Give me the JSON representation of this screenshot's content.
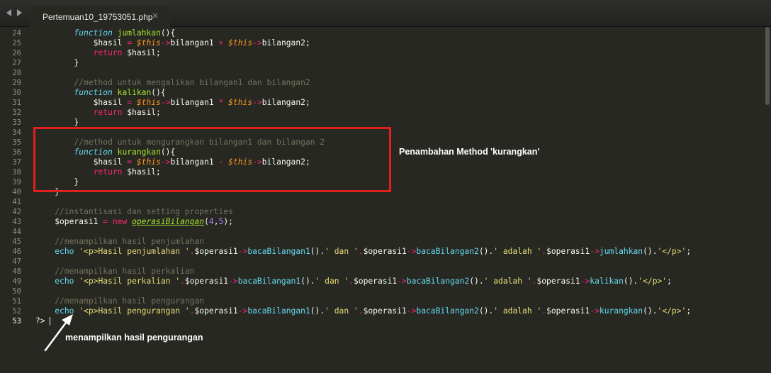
{
  "tab": {
    "title": "Pertemuan10_19753051.php",
    "close": "×"
  },
  "icons": {
    "nav_back": "chevron-left-icon",
    "nav_forward": "chevron-right-icon",
    "close": "close-icon",
    "annotation_arrow": "arrow-up-icon"
  },
  "colors": {
    "background": "#272822",
    "highlight_box": "#e01f1f",
    "annotation_text": "#ffffff"
  },
  "editor": {
    "current_line": 53,
    "lines": [
      {
        "num": "24",
        "tokens": [
          [
            "        ",
            "plain"
          ],
          [
            "function",
            "stor"
          ],
          [
            " ",
            "plain"
          ],
          [
            "jumlahkan",
            "fn"
          ],
          [
            "(){",
            "plain"
          ]
        ]
      },
      {
        "num": "25",
        "tokens": [
          [
            "            $hasil ",
            "plain"
          ],
          [
            "=",
            "op"
          ],
          [
            " ",
            "plain"
          ],
          [
            "$this",
            "this"
          ],
          [
            "->",
            "op"
          ],
          [
            "bilangan1 ",
            "plain"
          ],
          [
            "+",
            "op"
          ],
          [
            " ",
            "plain"
          ],
          [
            "$this",
            "this"
          ],
          [
            "->",
            "op"
          ],
          [
            "bilangan2;",
            "plain"
          ]
        ]
      },
      {
        "num": "26",
        "tokens": [
          [
            "            ",
            "plain"
          ],
          [
            "return",
            "kw"
          ],
          [
            " $hasil;",
            "plain"
          ]
        ]
      },
      {
        "num": "27",
        "tokens": [
          [
            "        }",
            "plain"
          ]
        ]
      },
      {
        "num": "28",
        "tokens": []
      },
      {
        "num": "29",
        "tokens": [
          [
            "        ",
            "plain"
          ],
          [
            "//method untuk mengalikan bilangan1 dan bilangan2",
            "cmt"
          ]
        ]
      },
      {
        "num": "30",
        "tokens": [
          [
            "        ",
            "plain"
          ],
          [
            "function",
            "stor"
          ],
          [
            " ",
            "plain"
          ],
          [
            "kalikan",
            "fn"
          ],
          [
            "(){",
            "plain"
          ]
        ]
      },
      {
        "num": "31",
        "tokens": [
          [
            "            $hasil ",
            "plain"
          ],
          [
            "=",
            "op"
          ],
          [
            " ",
            "plain"
          ],
          [
            "$this",
            "this"
          ],
          [
            "->",
            "op"
          ],
          [
            "bilangan1 ",
            "plain"
          ],
          [
            "*",
            "op"
          ],
          [
            " ",
            "plain"
          ],
          [
            "$this",
            "this"
          ],
          [
            "->",
            "op"
          ],
          [
            "bilangan2;",
            "plain"
          ]
        ]
      },
      {
        "num": "32",
        "tokens": [
          [
            "            ",
            "plain"
          ],
          [
            "return",
            "kw"
          ],
          [
            " $hasil;",
            "plain"
          ]
        ]
      },
      {
        "num": "33",
        "tokens": [
          [
            "        }",
            "plain"
          ]
        ]
      },
      {
        "num": "34",
        "tokens": []
      },
      {
        "num": "35",
        "tokens": [
          [
            "        ",
            "plain"
          ],
          [
            "//method untuk mengurangkan bilangan1 dan bilangan 2",
            "cmt"
          ]
        ]
      },
      {
        "num": "36",
        "tokens": [
          [
            "        ",
            "plain"
          ],
          [
            "function",
            "stor"
          ],
          [
            " ",
            "plain"
          ],
          [
            "kurangkan",
            "fn"
          ],
          [
            "(){",
            "plain"
          ]
        ]
      },
      {
        "num": "37",
        "tokens": [
          [
            "            $hasil ",
            "plain"
          ],
          [
            "=",
            "op"
          ],
          [
            " ",
            "plain"
          ],
          [
            "$this",
            "this"
          ],
          [
            "->",
            "op"
          ],
          [
            "bilangan1 ",
            "plain"
          ],
          [
            "-",
            "op"
          ],
          [
            " ",
            "plain"
          ],
          [
            "$this",
            "this"
          ],
          [
            "->",
            "op"
          ],
          [
            "bilangan2;",
            "plain"
          ]
        ]
      },
      {
        "num": "38",
        "tokens": [
          [
            "            ",
            "plain"
          ],
          [
            "return",
            "kw"
          ],
          [
            " $hasil;",
            "plain"
          ]
        ]
      },
      {
        "num": "39",
        "tokens": [
          [
            "        }",
            "plain"
          ]
        ]
      },
      {
        "num": "40",
        "tokens": [
          [
            "    }",
            "plain"
          ]
        ]
      },
      {
        "num": "41",
        "tokens": []
      },
      {
        "num": "42",
        "tokens": [
          [
            "    ",
            "plain"
          ],
          [
            "//instantisasi dan setting properties",
            "cmt"
          ]
        ]
      },
      {
        "num": "43",
        "tokens": [
          [
            "    $operasi1 ",
            "plain"
          ],
          [
            "=",
            "op"
          ],
          [
            " ",
            "plain"
          ],
          [
            "new",
            "kw"
          ],
          [
            " ",
            "plain"
          ],
          [
            "operasiBilangan",
            "class"
          ],
          [
            "(",
            "plain"
          ],
          [
            "4",
            "num"
          ],
          [
            ",",
            "plain"
          ],
          [
            "5",
            "num"
          ],
          [
            ");",
            "plain"
          ]
        ]
      },
      {
        "num": "44",
        "tokens": []
      },
      {
        "num": "45",
        "tokens": [
          [
            "    ",
            "plain"
          ],
          [
            "//menampilkan hasil penjumlahan",
            "cmt"
          ]
        ]
      },
      {
        "num": "46",
        "tokens": [
          [
            "    ",
            "plain"
          ],
          [
            "echo",
            "fncall"
          ],
          [
            " ",
            "plain"
          ],
          [
            "'<p>Hasil penjumlahan '",
            "str"
          ],
          [
            ".",
            "op"
          ],
          [
            "$operasi1",
            "plain"
          ],
          [
            "->",
            "op"
          ],
          [
            "bacaBilangan1",
            "fncall"
          ],
          [
            "().",
            "plain"
          ],
          [
            "' dan '",
            "str"
          ],
          [
            ".",
            "op"
          ],
          [
            "$operasi1",
            "plain"
          ],
          [
            "->",
            "op"
          ],
          [
            "bacaBilangan2",
            "fncall"
          ],
          [
            "().",
            "plain"
          ],
          [
            "' adalah '",
            "str"
          ],
          [
            ".",
            "op"
          ],
          [
            "$operasi1",
            "plain"
          ],
          [
            "->",
            "op"
          ],
          [
            "jumlahkan",
            "fncall"
          ],
          [
            "().",
            "plain"
          ],
          [
            "'</p>'",
            "str"
          ],
          [
            ";",
            "plain"
          ]
        ]
      },
      {
        "num": "47",
        "tokens": []
      },
      {
        "num": "48",
        "tokens": [
          [
            "    ",
            "plain"
          ],
          [
            "//menampilkan hasil perkalian",
            "cmt"
          ]
        ]
      },
      {
        "num": "49",
        "tokens": [
          [
            "    ",
            "plain"
          ],
          [
            "echo",
            "fncall"
          ],
          [
            " ",
            "plain"
          ],
          [
            "'<p>Hasil perkalian '",
            "str"
          ],
          [
            ".",
            "op"
          ],
          [
            "$operasi1",
            "plain"
          ],
          [
            "->",
            "op"
          ],
          [
            "bacaBilangan1",
            "fncall"
          ],
          [
            "().",
            "plain"
          ],
          [
            "' dan '",
            "str"
          ],
          [
            ".",
            "op"
          ],
          [
            "$operasi1",
            "plain"
          ],
          [
            "->",
            "op"
          ],
          [
            "bacaBilangan2",
            "fncall"
          ],
          [
            "().",
            "plain"
          ],
          [
            "' adalah '",
            "str"
          ],
          [
            ".",
            "op"
          ],
          [
            "$operasi1",
            "plain"
          ],
          [
            "->",
            "op"
          ],
          [
            "kalikan",
            "fncall"
          ],
          [
            "().",
            "plain"
          ],
          [
            "'</p>'",
            "str"
          ],
          [
            ";",
            "plain"
          ]
        ]
      },
      {
        "num": "50",
        "tokens": []
      },
      {
        "num": "51",
        "tokens": [
          [
            "    ",
            "plain"
          ],
          [
            "//menampilkan hasil pengurangan",
            "cmt"
          ]
        ]
      },
      {
        "num": "52",
        "tokens": [
          [
            "    ",
            "plain"
          ],
          [
            "echo",
            "fncall"
          ],
          [
            " ",
            "plain"
          ],
          [
            "'<p>Hasil pengurangan '",
            "str"
          ],
          [
            ".",
            "op"
          ],
          [
            "$operasi1",
            "plain"
          ],
          [
            "->",
            "op"
          ],
          [
            "bacaBilangan1",
            "fncall"
          ],
          [
            "().",
            "plain"
          ],
          [
            "' dan '",
            "str"
          ],
          [
            ".",
            "op"
          ],
          [
            "$operasi1",
            "plain"
          ],
          [
            "->",
            "op"
          ],
          [
            "bacaBilangan2",
            "fncall"
          ],
          [
            "().",
            "plain"
          ],
          [
            "' adalah '",
            "str"
          ],
          [
            ".",
            "op"
          ],
          [
            "$operasi1",
            "plain"
          ],
          [
            "->",
            "op"
          ],
          [
            "kurangkan",
            "fncall"
          ],
          [
            "().",
            "plain"
          ],
          [
            "'</p>'",
            "str"
          ],
          [
            ";",
            "plain"
          ]
        ]
      },
      {
        "num": "53",
        "tokens": [
          [
            "?>",
            "plain"
          ]
        ]
      }
    ]
  },
  "annotations": {
    "method_label": "Penambahan Method 'kurangkan'",
    "pengurangan_label": "menampilkan hasil pengurangan"
  }
}
